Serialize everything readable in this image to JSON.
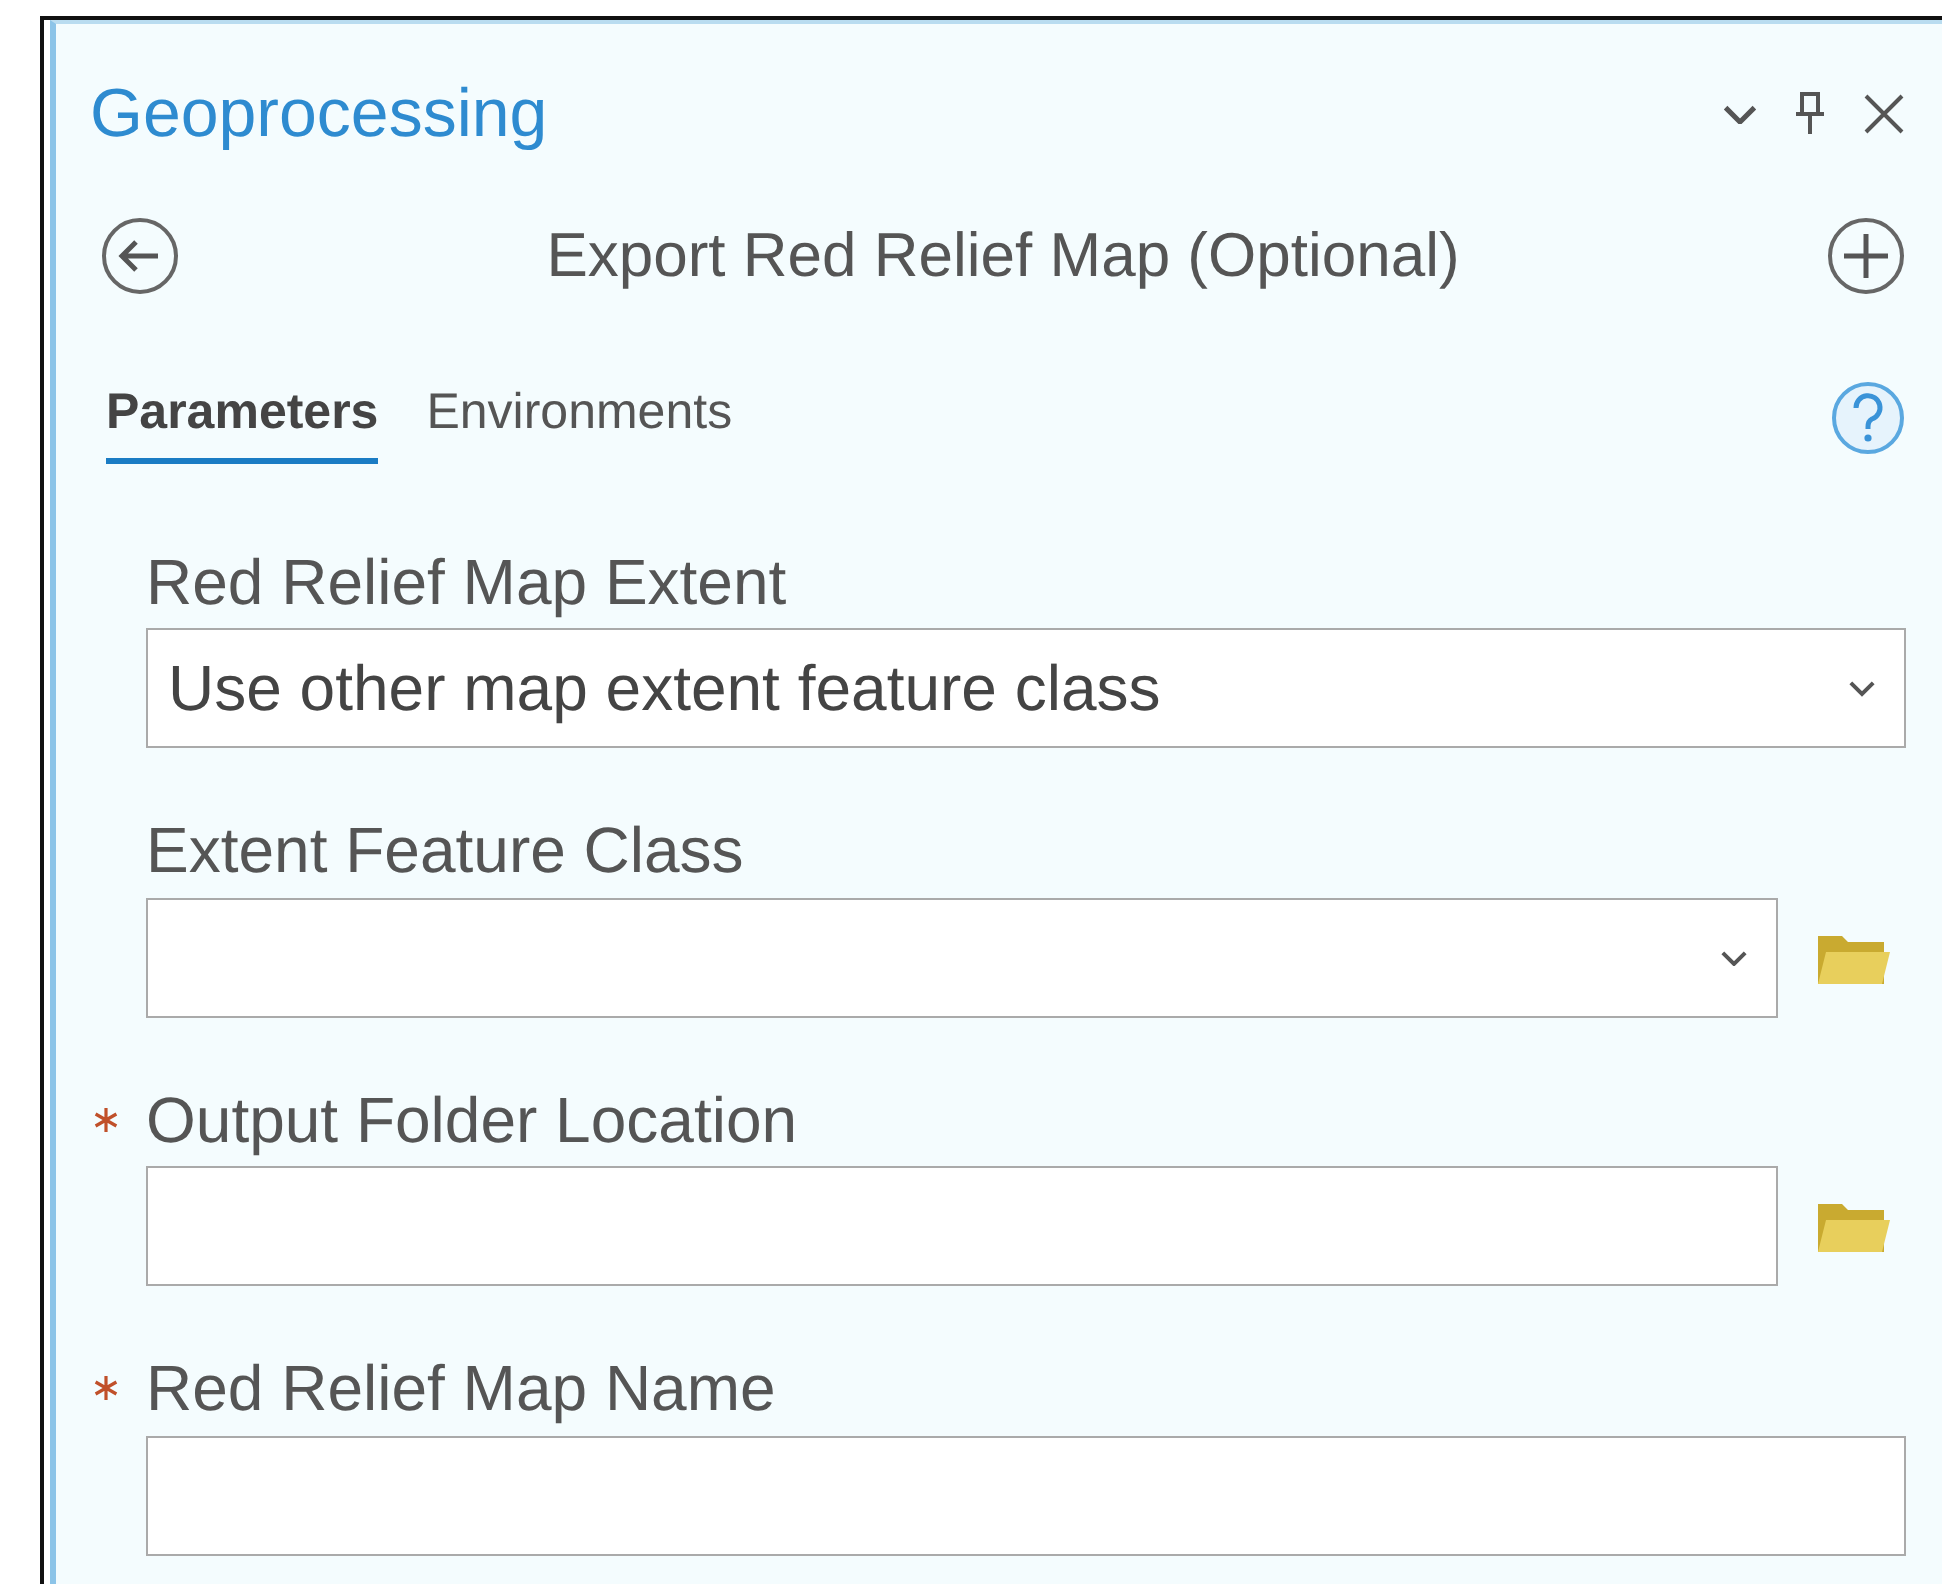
{
  "pane": {
    "title": "Geoprocessing"
  },
  "tool": {
    "title": "Export Red Relief Map (Optional)"
  },
  "tabs": [
    {
      "label": "Parameters",
      "selected": true
    },
    {
      "label": "Environments",
      "selected": false
    }
  ],
  "parameters": [
    {
      "kind": "combo",
      "label": "Red Relief Map Extent",
      "required": false,
      "value": "Use other map extent feature class"
    },
    {
      "kind": "combo_browse",
      "label": "Extent Feature Class",
      "required": false
    },
    {
      "kind": "text_browse",
      "label": "Output Folder Location",
      "required": true
    },
    {
      "kind": "text",
      "label": "Red Relief Map Name",
      "required": true
    }
  ]
}
